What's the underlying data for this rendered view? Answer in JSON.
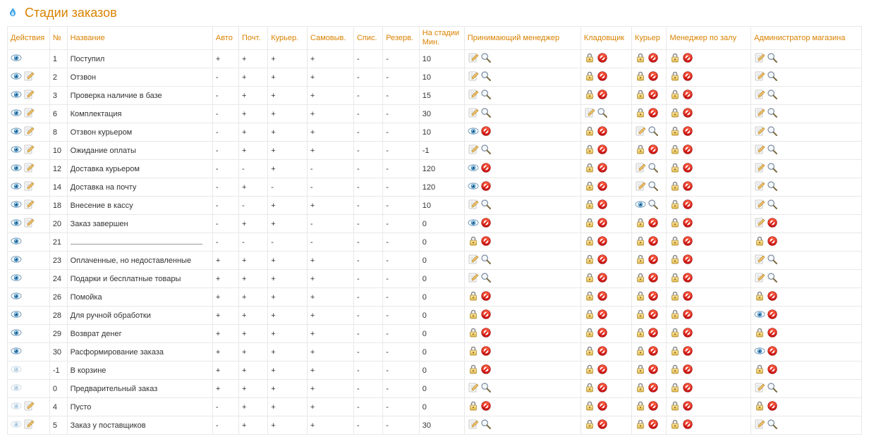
{
  "page_title": "Стадии заказов",
  "columns": {
    "actions": "Действия",
    "no": "№",
    "name": "Название",
    "auto": "Авто",
    "post": "Почт.",
    "courier": "Курьер.",
    "selfpick": "Самовыв.",
    "writeoff": "Спис.",
    "reserve": "Резерв.",
    "min": "На стадии Мин.",
    "recv_mgr": "Принимающий менеджер",
    "store": "Кладовщик",
    "kur": "Курьер",
    "hall_mgr": "Менеджер по залу",
    "admin": "Администратор магазина"
  },
  "icons": {
    "eye": "eye",
    "eye_dim": "eye-dim",
    "edit": "pencil",
    "lock": "lock",
    "magnifier": "magnifier",
    "stop": "stop"
  },
  "rows": [
    {
      "actions": [
        "eye"
      ],
      "no": "1",
      "name": "Поступил",
      "auto": "+",
      "post": "+",
      "courier": "+",
      "self": "+",
      "writeoff": "-",
      "reserve": "-",
      "min": "10",
      "recv": [
        "edit",
        "magnifier"
      ],
      "klad": [
        "lock",
        "stop"
      ],
      "kur": [
        "lock",
        "stop"
      ],
      "zal": [
        "lock",
        "stop"
      ],
      "adm": [
        "edit",
        "magnifier"
      ]
    },
    {
      "actions": [
        "eye",
        "edit"
      ],
      "no": "2",
      "name": "Отзвон",
      "auto": "-",
      "post": "+",
      "courier": "+",
      "self": "+",
      "writeoff": "-",
      "reserve": "-",
      "min": "10",
      "recv": [
        "edit",
        "magnifier"
      ],
      "klad": [
        "lock",
        "stop"
      ],
      "kur": [
        "lock",
        "stop"
      ],
      "zal": [
        "lock",
        "stop"
      ],
      "adm": [
        "edit",
        "magnifier"
      ]
    },
    {
      "actions": [
        "eye",
        "edit"
      ],
      "no": "3",
      "name": "Проверка наличие в базе",
      "auto": "-",
      "post": "+",
      "courier": "+",
      "self": "+",
      "writeoff": "-",
      "reserve": "-",
      "min": "15",
      "recv": [
        "edit",
        "magnifier"
      ],
      "klad": [
        "lock",
        "stop"
      ],
      "kur": [
        "lock",
        "stop"
      ],
      "zal": [
        "lock",
        "stop"
      ],
      "adm": [
        "edit",
        "magnifier"
      ]
    },
    {
      "actions": [
        "eye",
        "edit"
      ],
      "no": "6",
      "name": "Комплектация",
      "auto": "-",
      "post": "+",
      "courier": "+",
      "self": "+",
      "writeoff": "-",
      "reserve": "-",
      "min": "30",
      "recv": [
        "edit",
        "magnifier"
      ],
      "klad": [
        "edit",
        "magnifier"
      ],
      "kur": [
        "lock",
        "stop"
      ],
      "zal": [
        "lock",
        "stop"
      ],
      "adm": [
        "edit",
        "magnifier"
      ]
    },
    {
      "actions": [
        "eye",
        "edit"
      ],
      "no": "8",
      "name": "Отзвон курьером",
      "auto": "-",
      "post": "+",
      "courier": "+",
      "self": "+",
      "writeoff": "-",
      "reserve": "-",
      "min": "10",
      "recv": [
        "eye",
        "stop"
      ],
      "klad": [
        "lock",
        "stop"
      ],
      "kur": [
        "edit",
        "magnifier"
      ],
      "zal": [
        "lock",
        "stop"
      ],
      "adm": [
        "edit",
        "magnifier"
      ]
    },
    {
      "actions": [
        "eye",
        "edit"
      ],
      "no": "10",
      "name": "Ожидание оплаты",
      "auto": "-",
      "post": "+",
      "courier": "+",
      "self": "+",
      "writeoff": "-",
      "reserve": "-",
      "min": "-1",
      "recv": [
        "edit",
        "magnifier"
      ],
      "klad": [
        "lock",
        "stop"
      ],
      "kur": [
        "lock",
        "stop"
      ],
      "zal": [
        "lock",
        "stop"
      ],
      "adm": [
        "edit",
        "magnifier"
      ]
    },
    {
      "actions": [
        "eye",
        "edit"
      ],
      "no": "12",
      "name": "Доставка курьером",
      "auto": "-",
      "post": "-",
      "courier": "+",
      "self": "-",
      "writeoff": "-",
      "reserve": "-",
      "min": "120",
      "recv": [
        "eye",
        "stop"
      ],
      "klad": [
        "lock",
        "stop"
      ],
      "kur": [
        "edit",
        "magnifier"
      ],
      "zal": [
        "lock",
        "stop"
      ],
      "adm": [
        "edit",
        "magnifier"
      ]
    },
    {
      "actions": [
        "eye",
        "edit"
      ],
      "no": "14",
      "name": "Доставка на почту",
      "auto": "-",
      "post": "+",
      "courier": "-",
      "self": "-",
      "writeoff": "-",
      "reserve": "-",
      "min": "120",
      "recv": [
        "eye",
        "stop"
      ],
      "klad": [
        "lock",
        "stop"
      ],
      "kur": [
        "edit",
        "magnifier"
      ],
      "zal": [
        "lock",
        "stop"
      ],
      "adm": [
        "edit",
        "magnifier"
      ]
    },
    {
      "actions": [
        "eye",
        "edit"
      ],
      "no": "18",
      "name": "Внесение в кассу",
      "auto": "-",
      "post": "-",
      "courier": "+",
      "self": "+",
      "writeoff": "-",
      "reserve": "-",
      "min": "10",
      "recv": [
        "edit",
        "magnifier"
      ],
      "klad": [
        "lock",
        "stop"
      ],
      "kur": [
        "eye",
        "magnifier"
      ],
      "zal": [
        "lock",
        "stop"
      ],
      "adm": [
        "edit",
        "magnifier"
      ]
    },
    {
      "actions": [
        "eye",
        "edit"
      ],
      "no": "20",
      "name": "Заказ завершен",
      "auto": "-",
      "post": "+",
      "courier": "+",
      "self": "-",
      "writeoff": "-",
      "reserve": "-",
      "min": "0",
      "recv": [
        "eye",
        "stop"
      ],
      "klad": [
        "lock",
        "stop"
      ],
      "kur": [
        "lock",
        "stop"
      ],
      "zal": [
        "lock",
        "stop"
      ],
      "adm": [
        "edit",
        "stop"
      ]
    },
    {
      "actions": [
        "eye"
      ],
      "no": "21",
      "name": "__blank__",
      "auto": "-",
      "post": "-",
      "courier": "-",
      "self": "-",
      "writeoff": "-",
      "reserve": "-",
      "min": "0",
      "recv": [
        "lock",
        "stop"
      ],
      "klad": [
        "lock",
        "stop"
      ],
      "kur": [
        "lock",
        "stop"
      ],
      "zal": [
        "lock",
        "stop"
      ],
      "adm": [
        "lock",
        "stop"
      ]
    },
    {
      "actions": [
        "eye"
      ],
      "no": "23",
      "name": "Оплаченные, но недоставленные",
      "auto": "+",
      "post": "+",
      "courier": "+",
      "self": "+",
      "writeoff": "-",
      "reserve": "-",
      "min": "0",
      "recv": [
        "edit",
        "magnifier"
      ],
      "klad": [
        "lock",
        "stop"
      ],
      "kur": [
        "lock",
        "stop"
      ],
      "zal": [
        "lock",
        "stop"
      ],
      "adm": [
        "edit",
        "magnifier"
      ]
    },
    {
      "actions": [
        "eye"
      ],
      "no": "24",
      "name": "Подарки и бесплатные товары",
      "auto": "+",
      "post": "+",
      "courier": "+",
      "self": "+",
      "writeoff": "-",
      "reserve": "-",
      "min": "0",
      "recv": [
        "edit",
        "magnifier"
      ],
      "klad": [
        "lock",
        "stop"
      ],
      "kur": [
        "lock",
        "stop"
      ],
      "zal": [
        "lock",
        "stop"
      ],
      "adm": [
        "edit",
        "magnifier"
      ]
    },
    {
      "actions": [
        "eye"
      ],
      "no": "26",
      "name": "Помойка",
      "auto": "+",
      "post": "+",
      "courier": "+",
      "self": "+",
      "writeoff": "-",
      "reserve": "-",
      "min": "0",
      "recv": [
        "lock",
        "stop"
      ],
      "klad": [
        "lock",
        "stop"
      ],
      "kur": [
        "lock",
        "stop"
      ],
      "zal": [
        "lock",
        "stop"
      ],
      "adm": [
        "lock",
        "stop"
      ]
    },
    {
      "actions": [
        "eye"
      ],
      "no": "28",
      "name": "Для ручной обработки",
      "auto": "+",
      "post": "+",
      "courier": "+",
      "self": "+",
      "writeoff": "-",
      "reserve": "-",
      "min": "0",
      "recv": [
        "lock",
        "stop"
      ],
      "klad": [
        "lock",
        "stop"
      ],
      "kur": [
        "lock",
        "stop"
      ],
      "zal": [
        "lock",
        "stop"
      ],
      "adm": [
        "eye",
        "stop"
      ]
    },
    {
      "actions": [
        "eye"
      ],
      "no": "29",
      "name": "Возврат денег",
      "auto": "+",
      "post": "+",
      "courier": "+",
      "self": "+",
      "writeoff": "-",
      "reserve": "-",
      "min": "0",
      "recv": [
        "lock",
        "stop"
      ],
      "klad": [
        "lock",
        "stop"
      ],
      "kur": [
        "lock",
        "stop"
      ],
      "zal": [
        "lock",
        "stop"
      ],
      "adm": [
        "lock",
        "stop"
      ]
    },
    {
      "actions": [
        "eye"
      ],
      "no": "30",
      "name": "Расформирование заказа",
      "auto": "+",
      "post": "+",
      "courier": "+",
      "self": "+",
      "writeoff": "-",
      "reserve": "-",
      "min": "0",
      "recv": [
        "lock",
        "stop"
      ],
      "klad": [
        "lock",
        "stop"
      ],
      "kur": [
        "lock",
        "stop"
      ],
      "zal": [
        "lock",
        "stop"
      ],
      "adm": [
        "eye",
        "stop"
      ]
    },
    {
      "actions": [
        "eye_dim"
      ],
      "no": "-1",
      "name": "В корзине",
      "auto": "+",
      "post": "+",
      "courier": "+",
      "self": "+",
      "writeoff": "-",
      "reserve": "-",
      "min": "0",
      "recv": [
        "lock",
        "stop"
      ],
      "klad": [
        "lock",
        "stop"
      ],
      "kur": [
        "lock",
        "stop"
      ],
      "zal": [
        "lock",
        "stop"
      ],
      "adm": [
        "lock",
        "stop"
      ]
    },
    {
      "actions": [
        "eye_dim"
      ],
      "no": "0",
      "name": "Предварительный заказ",
      "auto": "+",
      "post": "+",
      "courier": "+",
      "self": "+",
      "writeoff": "-",
      "reserve": "-",
      "min": "0",
      "recv": [
        "edit",
        "magnifier"
      ],
      "klad": [
        "lock",
        "stop"
      ],
      "kur": [
        "lock",
        "stop"
      ],
      "zal": [
        "lock",
        "stop"
      ],
      "adm": [
        "edit",
        "magnifier"
      ]
    },
    {
      "actions": [
        "eye_dim",
        "edit"
      ],
      "no": "4",
      "name": "Пусто",
      "auto": "-",
      "post": "+",
      "courier": "+",
      "self": "+",
      "writeoff": "-",
      "reserve": "-",
      "min": "0",
      "recv": [
        "lock",
        "stop"
      ],
      "klad": [
        "lock",
        "stop"
      ],
      "kur": [
        "lock",
        "stop"
      ],
      "zal": [
        "lock",
        "stop"
      ],
      "adm": [
        "lock",
        "stop"
      ]
    },
    {
      "actions": [
        "eye_dim",
        "edit"
      ],
      "no": "5",
      "name": "Заказ у поставщиков",
      "auto": "-",
      "post": "+",
      "courier": "+",
      "self": "+",
      "writeoff": "-",
      "reserve": "-",
      "min": "30",
      "recv": [
        "edit",
        "magnifier"
      ],
      "klad": [
        "lock",
        "stop"
      ],
      "kur": [
        "lock",
        "stop"
      ],
      "zal": [
        "lock",
        "stop"
      ],
      "adm": [
        "edit",
        "magnifier"
      ]
    }
  ]
}
